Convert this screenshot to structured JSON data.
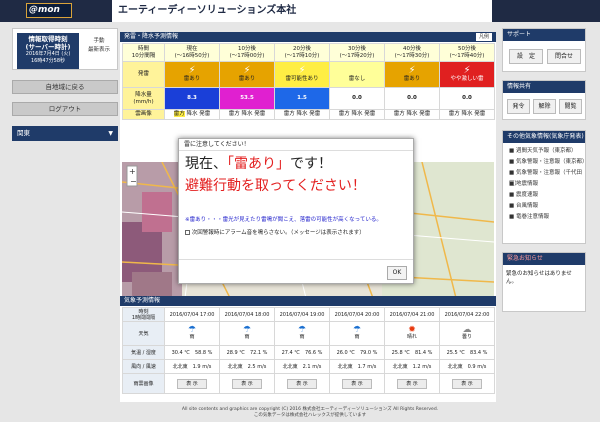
{
  "header": {
    "logo": "@mon",
    "title": "エーティーディーソリューションズ本社"
  },
  "left": {
    "info_label_1": "情報取得時刻",
    "info_label_2": "(サーバー時計)",
    "info_date": "2016年7月4日 (火)",
    "info_time": "16時47分58秒",
    "manual_line1": "手動",
    "manual_line2": "最新表示",
    "back_button": "自地域に戻る",
    "logout_button": "ログアウト",
    "region_label": "関東"
  },
  "forecast": {
    "section_title": "発雷・降水予測情報",
    "legend_button": "凡例",
    "row_header": [
      "時間",
      "10分間隔"
    ],
    "columns": [
      {
        "label": "現在",
        "range": "(～16時50分)",
        "status": "雷あり",
        "precip": "8.3"
      },
      {
        "label": "10分後",
        "range": "(～17時00分)",
        "status": "雷あり",
        "precip": "53.5"
      },
      {
        "label": "20分後",
        "range": "(～17時10分)",
        "status": "雷可能性あり",
        "precip": "1.5"
      },
      {
        "label": "30分後",
        "range": "(～17時20分)",
        "status": "雷なし",
        "precip": "0.0"
      },
      {
        "label": "40分後",
        "range": "(～17時30分)",
        "status": "雷あり",
        "precip": "0.0"
      },
      {
        "label": "50分後",
        "range": "(～17時40分)",
        "status": "やや激しい雷",
        "precip": "0.0"
      }
    ],
    "thunder_label": "発雷",
    "precip_label_1": "降水量",
    "precip_label_2": "(mm/h)",
    "cloud_label": "雲画像",
    "cloud_opts": [
      "雷方",
      "降水",
      "発雷"
    ],
    "colors": {
      "thunder": "#e6a300",
      "thunder_light": "#ffee44",
      "thunder_none": "#ffff99",
      "thunder_heavy": "#e02020",
      "precip_blue": "#1a3fd8",
      "precip_pink": "#e020d0",
      "precip_light": "#1e68e8"
    }
  },
  "modal": {
    "header": "雷に注意してください！",
    "line1_a": "現在、",
    "line1_b": "「雷あり」",
    "line1_c": "です！",
    "line2": "避難行動を取ってください！",
    "note": "※雷あり・・・雷光が見えたり雷鳴が聞こえ、落雷の可能性が高くなっている。",
    "checkbox_label": "次回警報時にアラーム音を鳴らさない。（メッセージは表示されます）",
    "ok_button": "OK"
  },
  "weather": {
    "section_title": "気象予測情報",
    "row_header": [
      "時刻",
      "1時間間隔"
    ],
    "times": [
      "2016/07/04 17:00",
      "2016/07/04 18:00",
      "2016/07/04 19:00",
      "2016/07/04 20:00",
      "2016/07/04 21:00",
      "2016/07/04 22:00"
    ],
    "weather_label": "天気",
    "weather": [
      "雨",
      "雨",
      "雨",
      "雨",
      "晴れ",
      "曇り"
    ],
    "temp_label": "気温 / 湿度",
    "temp": [
      "30.4 ℃",
      "28.9 ℃",
      "27.4 ℃",
      "26.0 ℃",
      "25.8 ℃",
      "25.5 ℃"
    ],
    "hum": [
      "58.8 %",
      "72.1 %",
      "76.6 %",
      "79.0 %",
      "81.4 %",
      "83.4 %"
    ],
    "wind_label": "風向 / 風速",
    "wind_dir": [
      "北北東",
      "北北東",
      "北北東",
      "北北東",
      "北北東",
      "北北東"
    ],
    "wind_speed": [
      "1.9 m/s",
      "2.5 m/s",
      "2.1 m/s",
      "1.7 m/s",
      "1.2 m/s",
      "0.9 m/s"
    ],
    "rain_label": "雨雲画像",
    "show_button": "表 示"
  },
  "right": {
    "support_title": "サポート",
    "settings_button": "設　定",
    "contact_button": "問合せ",
    "report_title": "情報共有",
    "report_buttons": [
      "発令",
      "解除",
      "閲覧"
    ],
    "alert_title": "その他気象情報(気象庁発表)",
    "alerts": [
      "■ 週間天気予報（東京都）",
      "■ 気象警報・注意報（東京都）",
      "■ 気象警報・注意報（千代田区）",
      "■ 地震情報",
      "■ 震度速報",
      "■ 台風情報",
      "■ 竜巻注意情報"
    ],
    "notice_title": "緊急お知らせ",
    "notice_text": "緊急のお知らせはありません。"
  },
  "footer": {
    "line1": "All site contents and graphics are copyright (C) 2016 株式会社エーティーディーソリューションズ All Rights Reserved.",
    "line2": "この気象データは株式会社ハレックスが提供しています"
  }
}
